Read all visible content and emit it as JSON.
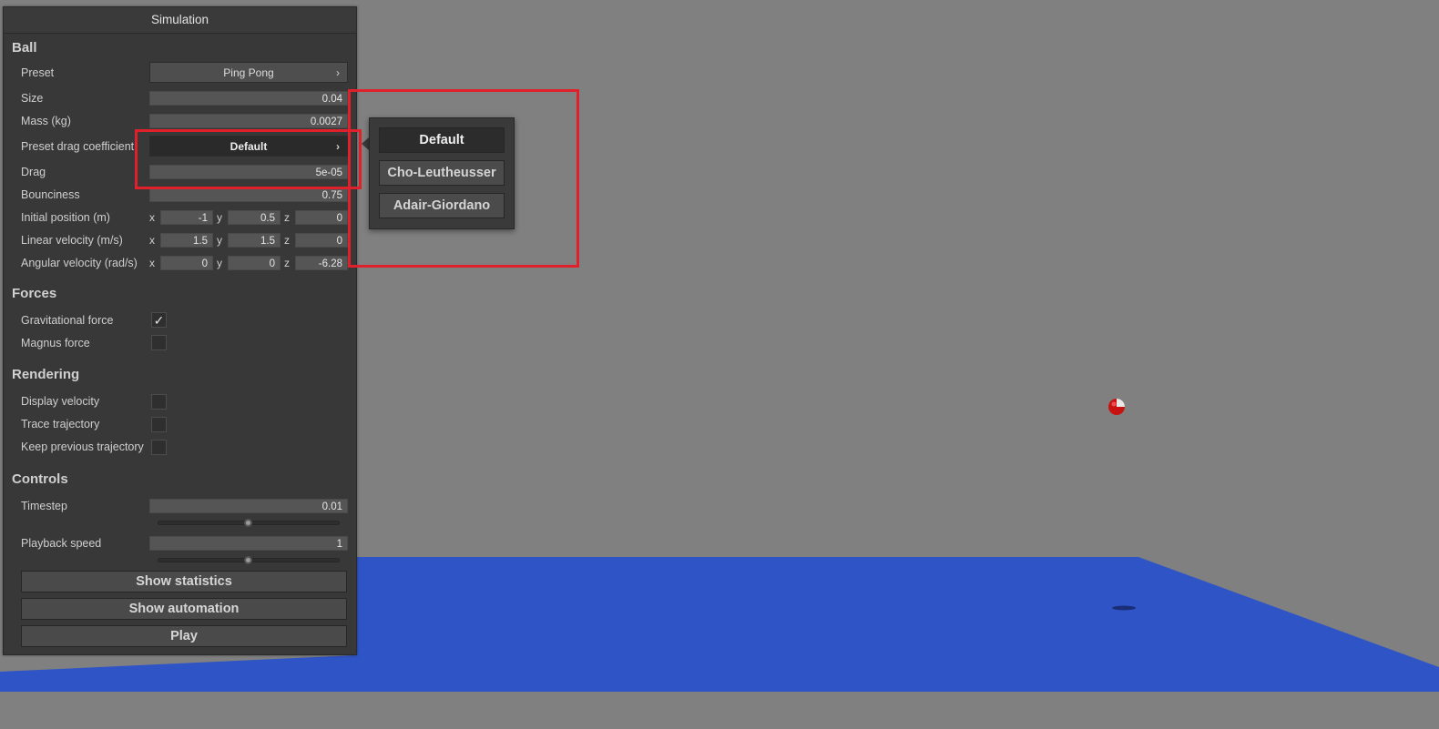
{
  "panel": {
    "title": "Simulation",
    "ball": {
      "heading": "Ball",
      "preset_label": "Preset",
      "preset_value": "Ping Pong",
      "size_label": "Size",
      "size_value": "0.04",
      "mass_label": "Mass (kg)",
      "mass_value": "0.0027",
      "drag_preset_label": "Preset drag coefficient",
      "drag_preset_value": "Default",
      "drag_label": "Drag",
      "drag_value": "5e-05",
      "bounciness_label": "Bounciness",
      "bounciness_value": "0.75",
      "init_pos_label": "Initial position (m)",
      "init_pos": {
        "x": "-1",
        "y": "0.5",
        "z": "0"
      },
      "lin_vel_label": "Linear velocity (m/s)",
      "lin_vel": {
        "x": "1.5",
        "y": "1.5",
        "z": "0"
      },
      "ang_vel_label": "Angular velocity (rad/s)",
      "ang_vel": {
        "x": "0",
        "y": "0",
        "z": "-6.28"
      },
      "axis_x": "x",
      "axis_y": "y",
      "axis_z": "z"
    },
    "forces": {
      "heading": "Forces",
      "gravity_label": "Gravitational force",
      "gravity_checked": true,
      "magnus_label": "Magnus force",
      "magnus_checked": false
    },
    "rendering": {
      "heading": "Rendering",
      "display_velocity_label": "Display velocity",
      "trace_trajectory_label": "Trace trajectory",
      "keep_previous_label": "Keep previous trajectory"
    },
    "controls": {
      "heading": "Controls",
      "timestep_label": "Timestep",
      "timestep_value": "0.01",
      "timestep_slider_fraction": 0.5,
      "playback_label": "Playback speed",
      "playback_value": "1",
      "playback_slider_fraction": 0.5,
      "show_statistics": "Show statistics",
      "show_automation": "Show automation",
      "play": "Play"
    }
  },
  "drag_popup": {
    "items": [
      "Default",
      "Cho-Leutheusser",
      "Adair-Giordano"
    ],
    "selected": "Default"
  },
  "icons": {
    "chevron": "›",
    "check": "✓"
  },
  "colors": {
    "background": "#808080",
    "floor": "#2f54c6",
    "ball": "#cc1010",
    "highlight": "#e0202a"
  }
}
